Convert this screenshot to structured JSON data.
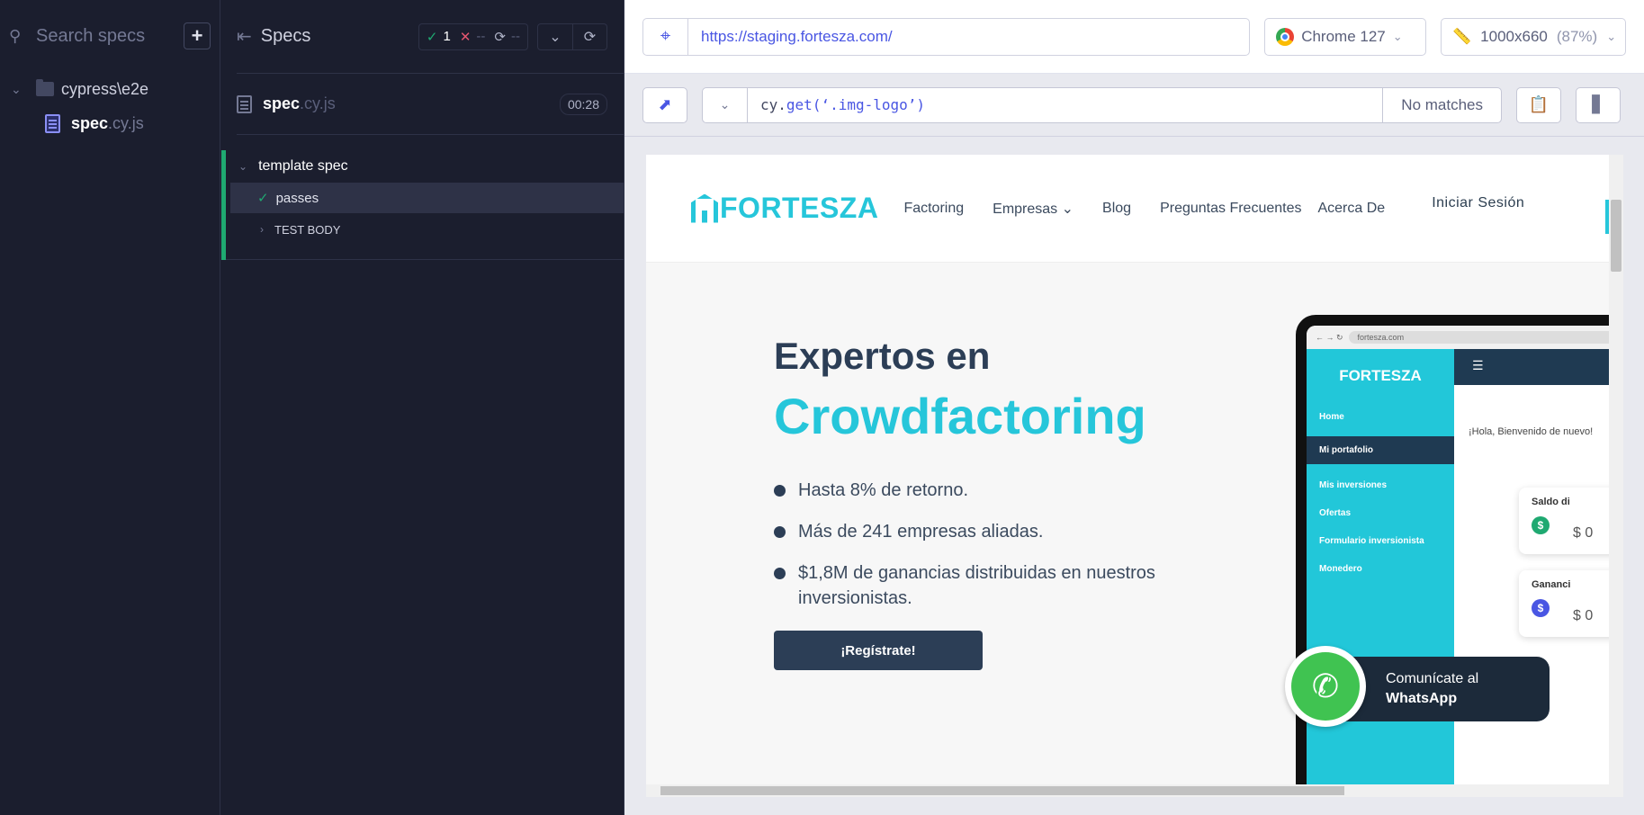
{
  "spec_panel": {
    "search_placeholder": "Search specs",
    "add_label": "+",
    "folder": "cypress\\e2e",
    "file_name": "spec",
    "file_ext": ".cy.js"
  },
  "reporter": {
    "title": "Specs",
    "stats": {
      "passed": "1",
      "failed": "--",
      "pending": "--"
    },
    "spec_name": "spec",
    "spec_ext": ".cy.js",
    "duration": "00:28",
    "suite_title": "template spec",
    "test_title": "passes",
    "test_body": "TEST BODY"
  },
  "aut": {
    "url": "https://staging.fortesza.com/",
    "browser": "Chrome 127",
    "viewport": "1000x660",
    "zoom": "(87%)",
    "selector_prefix": "cy.",
    "selector_fn": "get",
    "selector_arg": "(‘.img-logo’)",
    "matches": "No matches"
  },
  "site": {
    "logo": "FORTESZA",
    "nav": [
      "Factoring",
      "Empresas",
      "Blog",
      "Preguntas Frecuentes",
      "Acerca De"
    ],
    "login": "Iniciar Sesión",
    "hero_line1": "Expertos en",
    "hero_line2": "Crowdfactoring",
    "bullets": [
      "Hasta 8% de retorno.",
      "Más de 241 empresas aliadas.",
      "$1,8M de ganancias distribuidas en nuestros inversionistas."
    ],
    "cta": "¡Regístrate!",
    "tablet": {
      "address": "fortesza.com",
      "logo": "FORTESZA",
      "menu": [
        "Home",
        "Mi portafolio",
        "Mis inversiones",
        "Ofertas",
        "Formulario inversionista",
        "Monedero"
      ],
      "welcome": "¡Hola, Bienvenido de nuevo!",
      "card1_title": "Saldo di",
      "card1_amount": "$ 0",
      "card2_title": "Gananci",
      "card2_amount": "$ 0"
    },
    "whatsapp_line1": "Comunícate al",
    "whatsapp_line2": "WhatsApp"
  },
  "colors": {
    "accent": "#26c6da",
    "navy": "#2c3e56",
    "pass": "#1fa971",
    "fail": "#e45770",
    "cypress_indigo": "#4956e3"
  }
}
